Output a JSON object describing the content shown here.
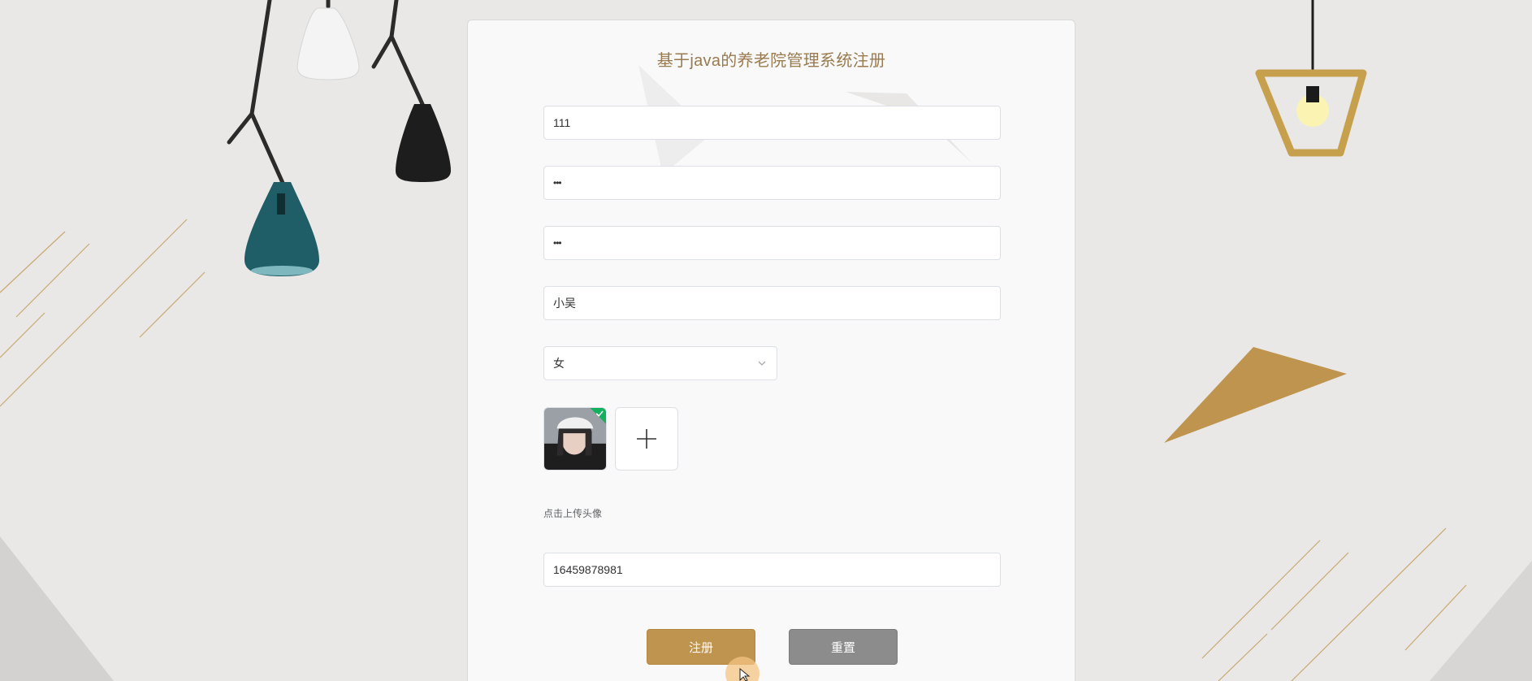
{
  "form": {
    "title": "基于java的养老院管理系统注册",
    "account_value": "111",
    "password_value": "•••",
    "confirm_password_value": "•••",
    "name_value": "小吴",
    "gender_value": "女",
    "upload_hint": "点击上传头像",
    "phone_value": "16459878981"
  },
  "buttons": {
    "register": "注册",
    "reset": "重置"
  },
  "icons": {
    "select": "chevron-down-icon",
    "add": "plus-icon",
    "cursor": "pointer-cursor-icon"
  },
  "colors": {
    "accent": "#bf944f",
    "title": "#9a7a4f",
    "reset": "#8c8c8c",
    "background": "#e9e8e6"
  }
}
